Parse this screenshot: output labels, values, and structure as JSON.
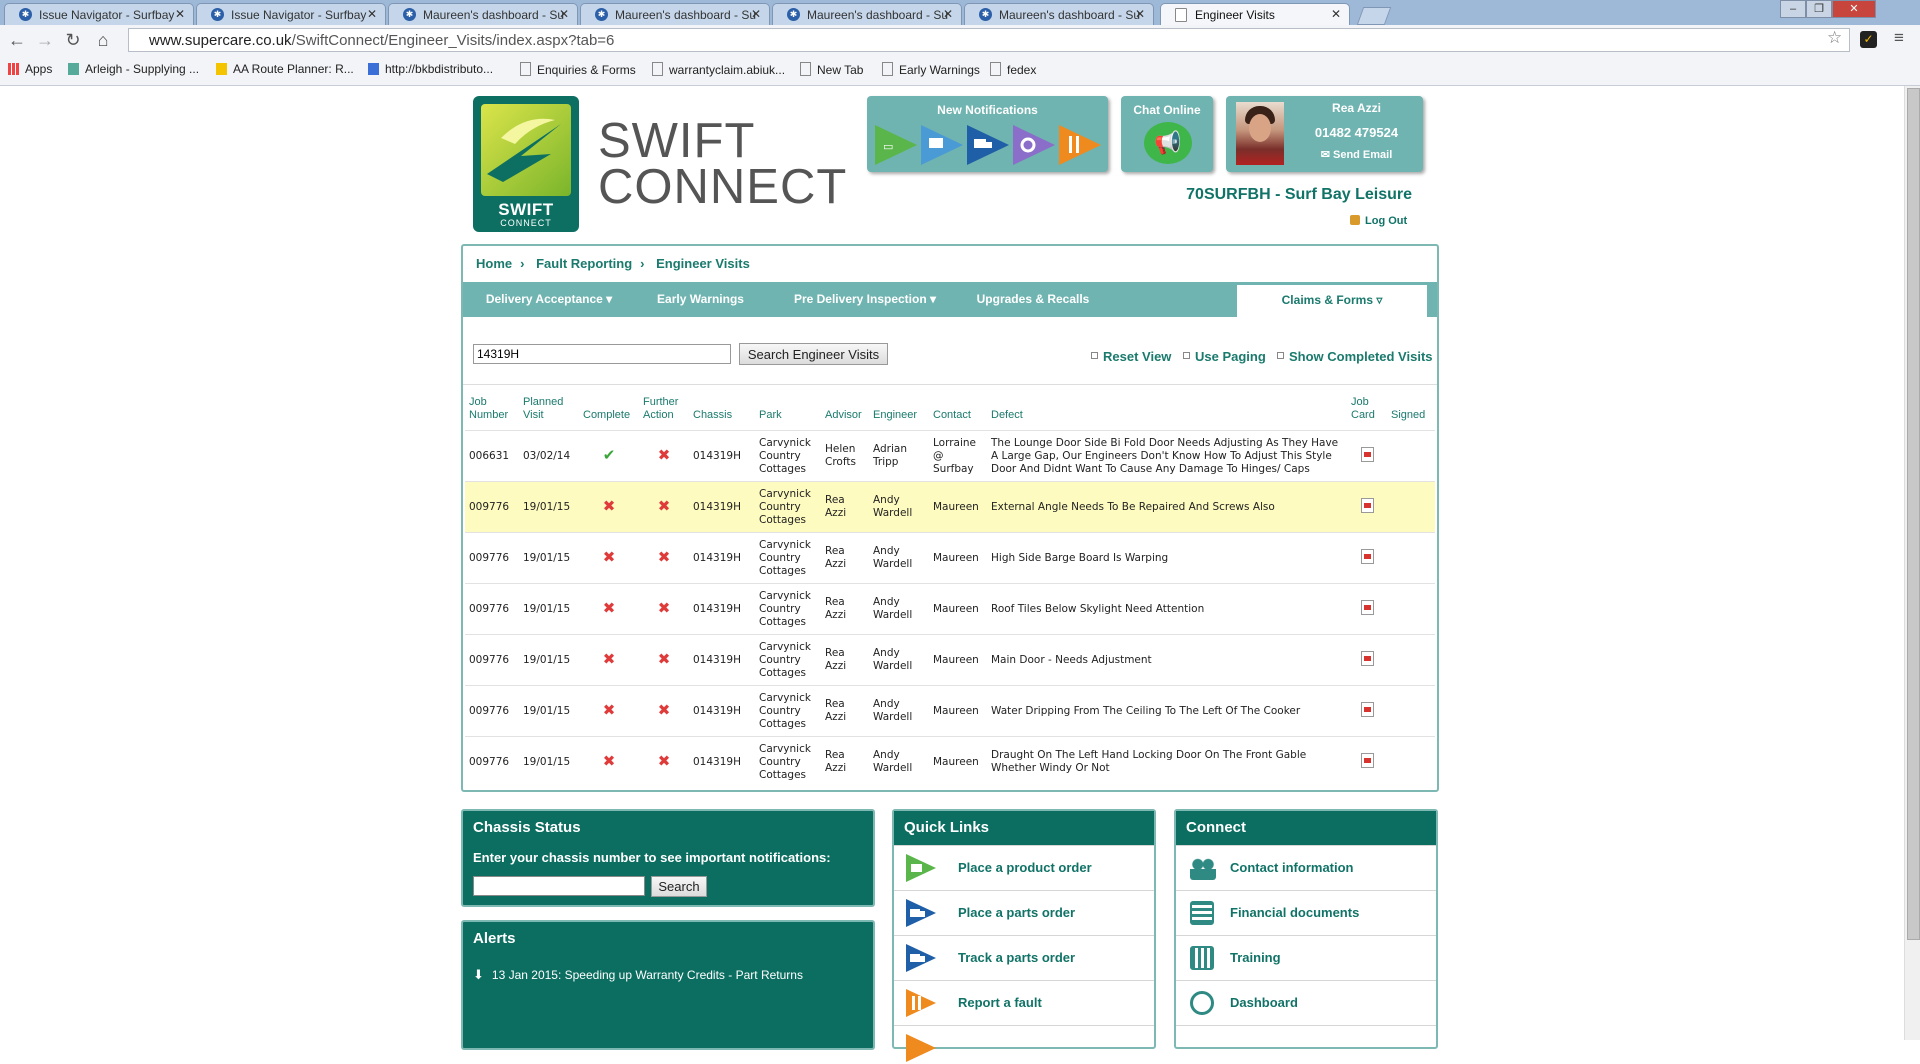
{
  "browser": {
    "tabs": [
      {
        "title": "Issue Navigator - Surfbay"
      },
      {
        "title": "Issue Navigator - Surfbay"
      },
      {
        "title": "Maureen's dashboard - Su"
      },
      {
        "title": "Maureen's dashboard - Su"
      },
      {
        "title": "Maureen's dashboard - Su"
      },
      {
        "title": "Maureen's dashboard - Su"
      },
      {
        "title": "Engineer Visits"
      }
    ],
    "url_host": "www.supercare.co.uk",
    "url_path": "/SwiftConnect/Engineer_Visits/index.aspx?tab=6",
    "bookmarks": [
      "Apps",
      "Arleigh - Supplying ...",
      "AA Route Planner: R...",
      "http://bkbdistributo...",
      "Enquiries & Forms",
      "warrantyclaim.abiuk...",
      "New Tab",
      "Early Warnings",
      "fedex"
    ]
  },
  "header": {
    "logo_text_1": "SWIFT",
    "logo_text_2": "CONNECT",
    "wordmark_1": "SWIFT",
    "wordmark_2": "CONNECT",
    "notifications_title": "New Notifications",
    "notification_icons": [
      "product-order-icon",
      "monitor-icon",
      "truck-icon",
      "gear-icon",
      "tools-icon"
    ],
    "chat_title": "Chat Online",
    "user_name": "Rea Azzi",
    "user_phone": "01482 479524",
    "send_email": "Send Email",
    "dealer": "70SURFBH - Surf Bay Leisure",
    "logout": "Log Out"
  },
  "breadcrumb": [
    "Home",
    "Fault Reporting",
    "Engineer Visits"
  ],
  "nav": [
    {
      "label": "Delivery Acceptance ▾"
    },
    {
      "label": "Early Warnings"
    },
    {
      "label": "Pre Delivery Inspection ▾"
    },
    {
      "label": "Upgrades & Recalls"
    },
    {
      "label": "Claims & Forms ▿"
    }
  ],
  "search": {
    "value": "14319H",
    "button": "Search Engineer Visits",
    "reset": "Reset View",
    "paging": "Use Paging",
    "completed": "Show Completed Visits"
  },
  "table": {
    "headers": [
      "Job Number",
      "Planned Visit",
      "Complete",
      "Further Action",
      "Chassis",
      "Park",
      "Advisor",
      "Engineer",
      "Contact",
      "Defect",
      "Job Card",
      "Signed"
    ],
    "rows": [
      {
        "job": "006631",
        "visit": "03/02/14",
        "complete": "✔",
        "further": "✖",
        "chassis": "014319H",
        "park": "Carvynick Country Cottages",
        "advisor": "Helen Crofts",
        "engineer": "Adrian Tripp",
        "contact": "Lorraine @ Surfbay",
        "defect": "The Lounge Door Side Bi Fold Door Needs Adjusting As They Have A Large Gap, Our Engineers Don't Know How To Adjust This Style Door And Didnt Want To Cause Any Damage To Hinges/ Caps"
      },
      {
        "job": "009776",
        "visit": "19/01/15",
        "complete": "✖",
        "further": "✖",
        "chassis": "014319H",
        "park": "Carvynick Country Cottages",
        "advisor": "Rea Azzi",
        "engineer": "Andy Wardell",
        "contact": "Maureen",
        "defect": "External Angle Needs To Be Repaired And Screws Also"
      },
      {
        "job": "009776",
        "visit": "19/01/15",
        "complete": "✖",
        "further": "✖",
        "chassis": "014319H",
        "park": "Carvynick Country Cottages",
        "advisor": "Rea Azzi",
        "engineer": "Andy Wardell",
        "contact": "Maureen",
        "defect": "High Side Barge Board Is Warping"
      },
      {
        "job": "009776",
        "visit": "19/01/15",
        "complete": "✖",
        "further": "✖",
        "chassis": "014319H",
        "park": "Carvynick Country Cottages",
        "advisor": "Rea Azzi",
        "engineer": "Andy Wardell",
        "contact": "Maureen",
        "defect": "Roof Tiles Below Skylight Need Attention"
      },
      {
        "job": "009776",
        "visit": "19/01/15",
        "complete": "✖",
        "further": "✖",
        "chassis": "014319H",
        "park": "Carvynick Country Cottages",
        "advisor": "Rea Azzi",
        "engineer": "Andy Wardell",
        "contact": "Maureen",
        "defect": "Main Door - Needs Adjustment"
      },
      {
        "job": "009776",
        "visit": "19/01/15",
        "complete": "✖",
        "further": "✖",
        "chassis": "014319H",
        "park": "Carvynick Country Cottages",
        "advisor": "Rea Azzi",
        "engineer": "Andy Wardell",
        "contact": "Maureen",
        "defect": "Water Dripping From The Ceiling To The Left Of The Cooker"
      },
      {
        "job": "009776",
        "visit": "19/01/15",
        "complete": "✖",
        "further": "✖",
        "chassis": "014319H",
        "park": "Carvynick Country Cottages",
        "advisor": "Rea Azzi",
        "engineer": "Andy Wardell",
        "contact": "Maureen",
        "defect": "Draught On The Left Hand Locking Door On The Front Gable Whether Windy Or Not"
      }
    ]
  },
  "chassis_status": {
    "title": "Chassis Status",
    "prompt": "Enter your chassis number to see important notifications:",
    "button": "Search"
  },
  "alerts": {
    "title": "Alerts",
    "items": [
      "13 Jan 2015: Speeding up Warranty Credits - Part Returns"
    ]
  },
  "quick_links": {
    "title": "Quick Links",
    "items": [
      "Place a product order",
      "Place a parts order",
      "Track a parts order",
      "Report a fault"
    ]
  },
  "connect": {
    "title": "Connect",
    "items": [
      "Contact information",
      "Financial documents",
      "Training",
      "Dashboard"
    ]
  },
  "colors": {
    "teal": "#6fb4b0",
    "dark_teal": "#0c6e61",
    "link": "#117367",
    "highlight": "#fdfbc0"
  }
}
